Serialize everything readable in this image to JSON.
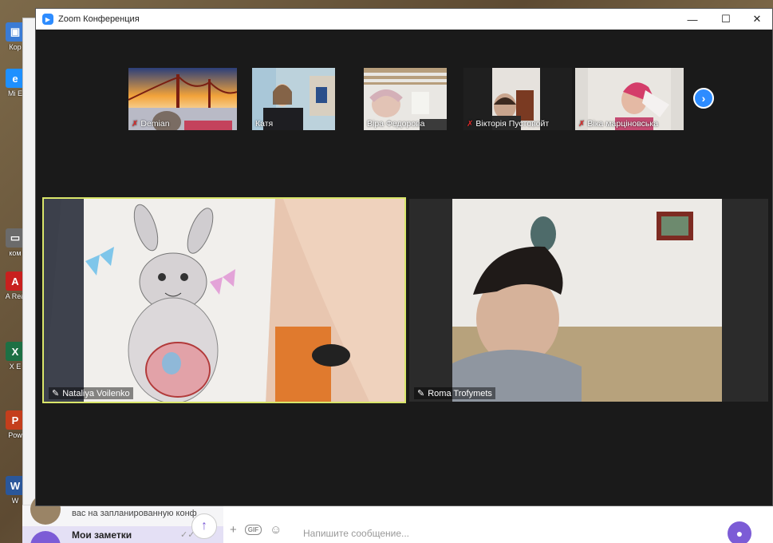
{
  "window": {
    "title": "Zoom Конференция"
  },
  "thumbnails": [
    {
      "name": "Demian",
      "muted": true
    },
    {
      "name": "Катя",
      "muted": false
    },
    {
      "name": "Віра Федорова",
      "muted": false
    },
    {
      "name": "Вікторія Пустовойт",
      "muted": true
    },
    {
      "name": "Віка марціновська",
      "muted": true
    }
  ],
  "main_videos": [
    {
      "name": "Nataliya Voilenko",
      "pinned": true,
      "active_speaker": true
    },
    {
      "name": "Roma Trofymets",
      "pinned": true,
      "active_speaker": false
    }
  ],
  "desktop_icons": [
    "Кор",
    "Mi E",
    "ком",
    "A Rea",
    "X E",
    "Pow",
    "W"
  ],
  "messenger": {
    "snippet": "вас на запланированную конф",
    "notes_label": "Мои заметки",
    "input_placeholder": "Напишите сообщение...",
    "gif_label": "GIF"
  },
  "colors": {
    "zoom_blue": "#2d8cff",
    "active_border": "#d9e66a",
    "messenger_accent": "#7c5cd6"
  }
}
